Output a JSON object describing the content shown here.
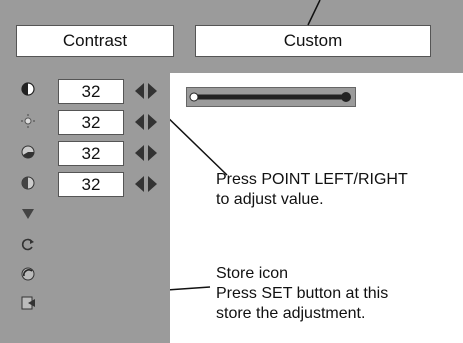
{
  "header": {
    "mode_label": "Contrast",
    "value_label": "Custom"
  },
  "rows": [
    {
      "icon": "contrast-icon",
      "value": "32"
    },
    {
      "icon": "brightness-icon",
      "value": "32"
    },
    {
      "icon": "color-icon",
      "value": "32"
    },
    {
      "icon": "tint-icon",
      "value": "32"
    }
  ],
  "callouts": {
    "point_line1": "Press POINT LEFT/RIGHT",
    "point_line2": "to adjust value.",
    "store_line1": "Store icon",
    "store_line2": "Press SET button at this",
    "store_line3": "store the adjustment."
  }
}
